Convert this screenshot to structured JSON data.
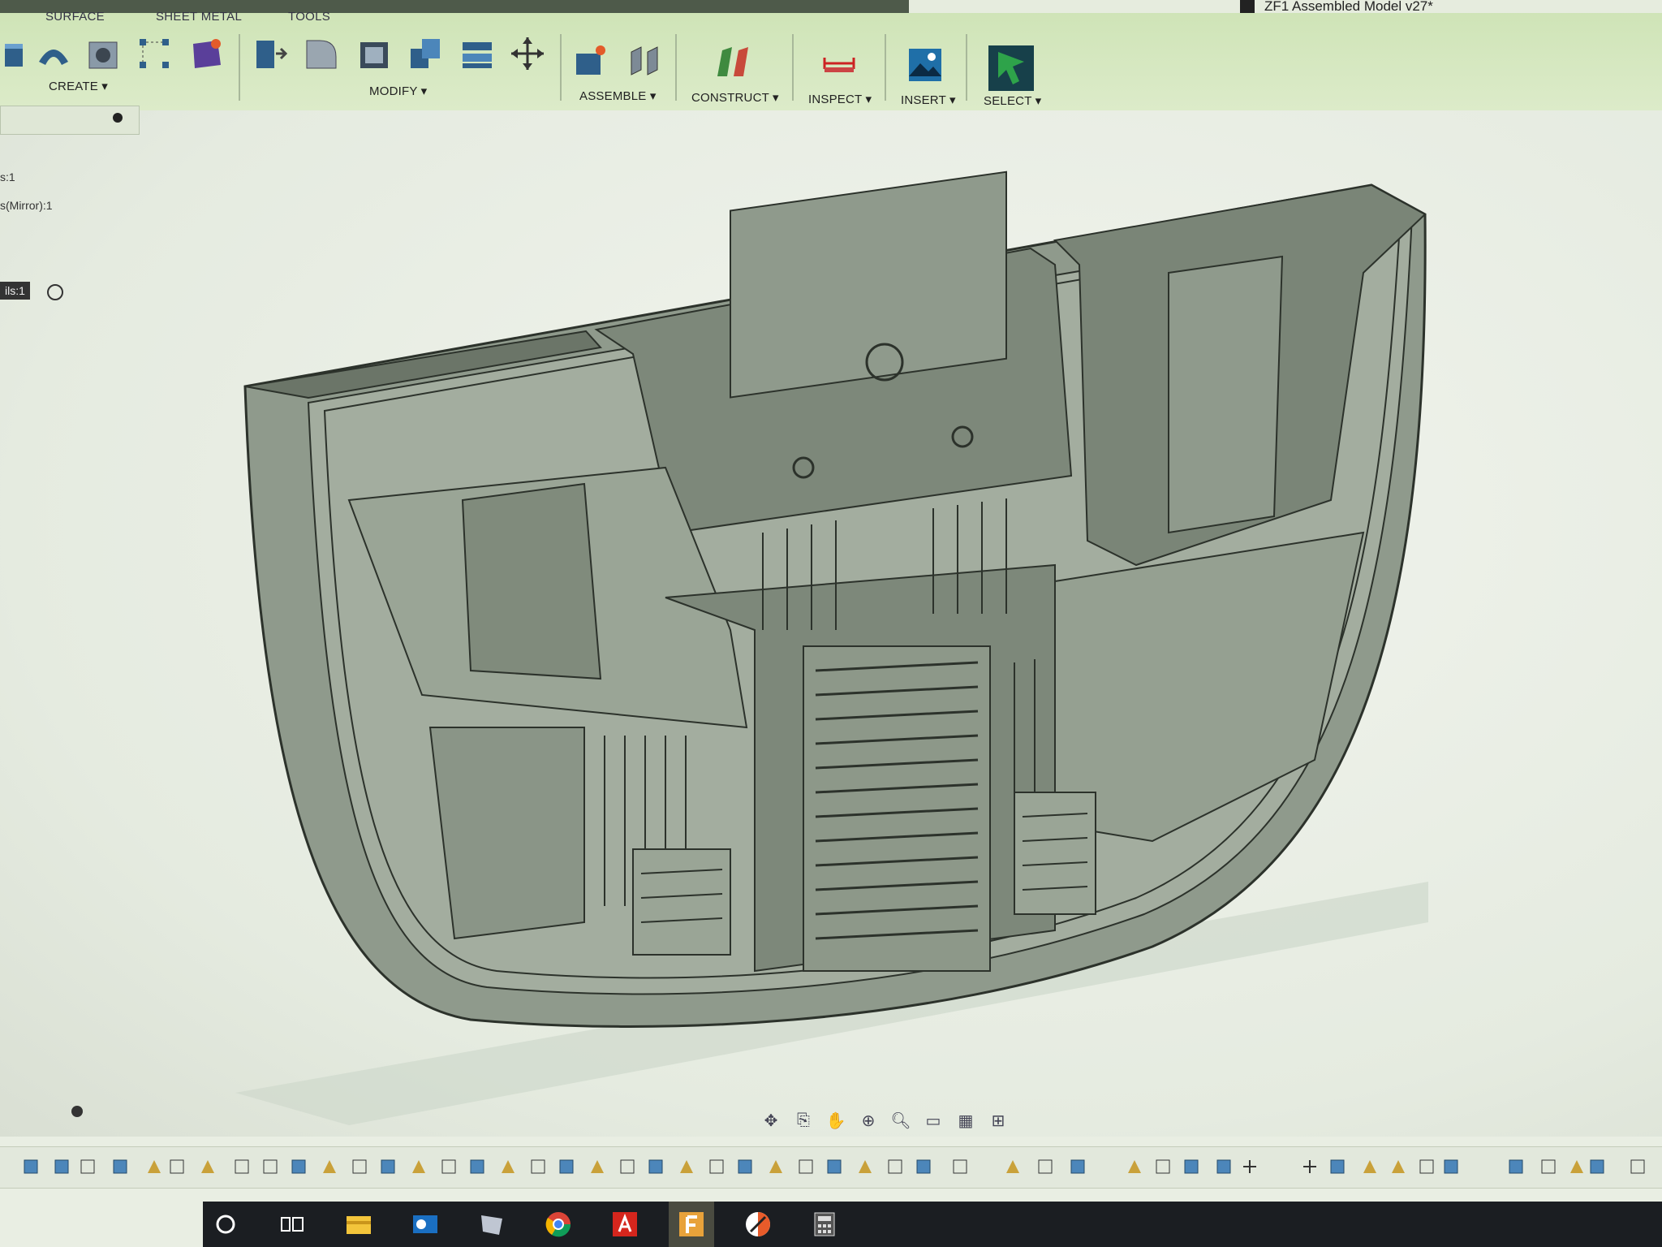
{
  "window": {
    "title": "ZF1 Assembled Model v27*"
  },
  "ribbon": {
    "tabs": [
      "SURFACE",
      "SHEET METAL",
      "TOOLS"
    ],
    "groups": {
      "create": "CREATE ▾",
      "modify": "MODIFY ▾",
      "assemble": "ASSEMBLE ▾",
      "construct": "CONSTRUCT ▾",
      "inspect": "INSPECT ▾",
      "insert": "INSERT ▾",
      "select": "SELECT ▾"
    },
    "icons": [
      "extrude-icon",
      "revolve-icon",
      "hole-icon",
      "pattern-icon",
      "create-form-icon",
      "press-pull-icon",
      "fillet-icon",
      "shell-icon",
      "combine-icon",
      "align-icon",
      "move-icon",
      "new-component-icon",
      "joint-icon",
      "offset-plane-icon",
      "measure-icon",
      "insert-image-icon",
      "select-icon"
    ]
  },
  "browser": {
    "items": [
      "s:1",
      "s(Mirror):1",
      "ils:1"
    ]
  },
  "viewport": {
    "model": "3d-model-cutaway",
    "colors": {
      "model_fill": "#8f9a8c",
      "model_dark": "#5b6459",
      "model_light": "#b7c0b3",
      "edge": "#2c322b"
    }
  },
  "navigation_bar": {
    "icons": [
      "orbit-icon",
      "look-at-icon",
      "pan-icon",
      "zoom-fit-icon",
      "zoom-icon",
      "display-settings-icon",
      "grid-icon",
      "viewports-icon"
    ]
  },
  "taskbar": {
    "icons": [
      "search-circle-icon",
      "task-view-icon",
      "file-explorer-icon",
      "outlook-icon",
      "onenote-icon",
      "chrome-icon",
      "acrobat-icon",
      "fusion-icon",
      "app-icon",
      "calculator-icon"
    ]
  }
}
